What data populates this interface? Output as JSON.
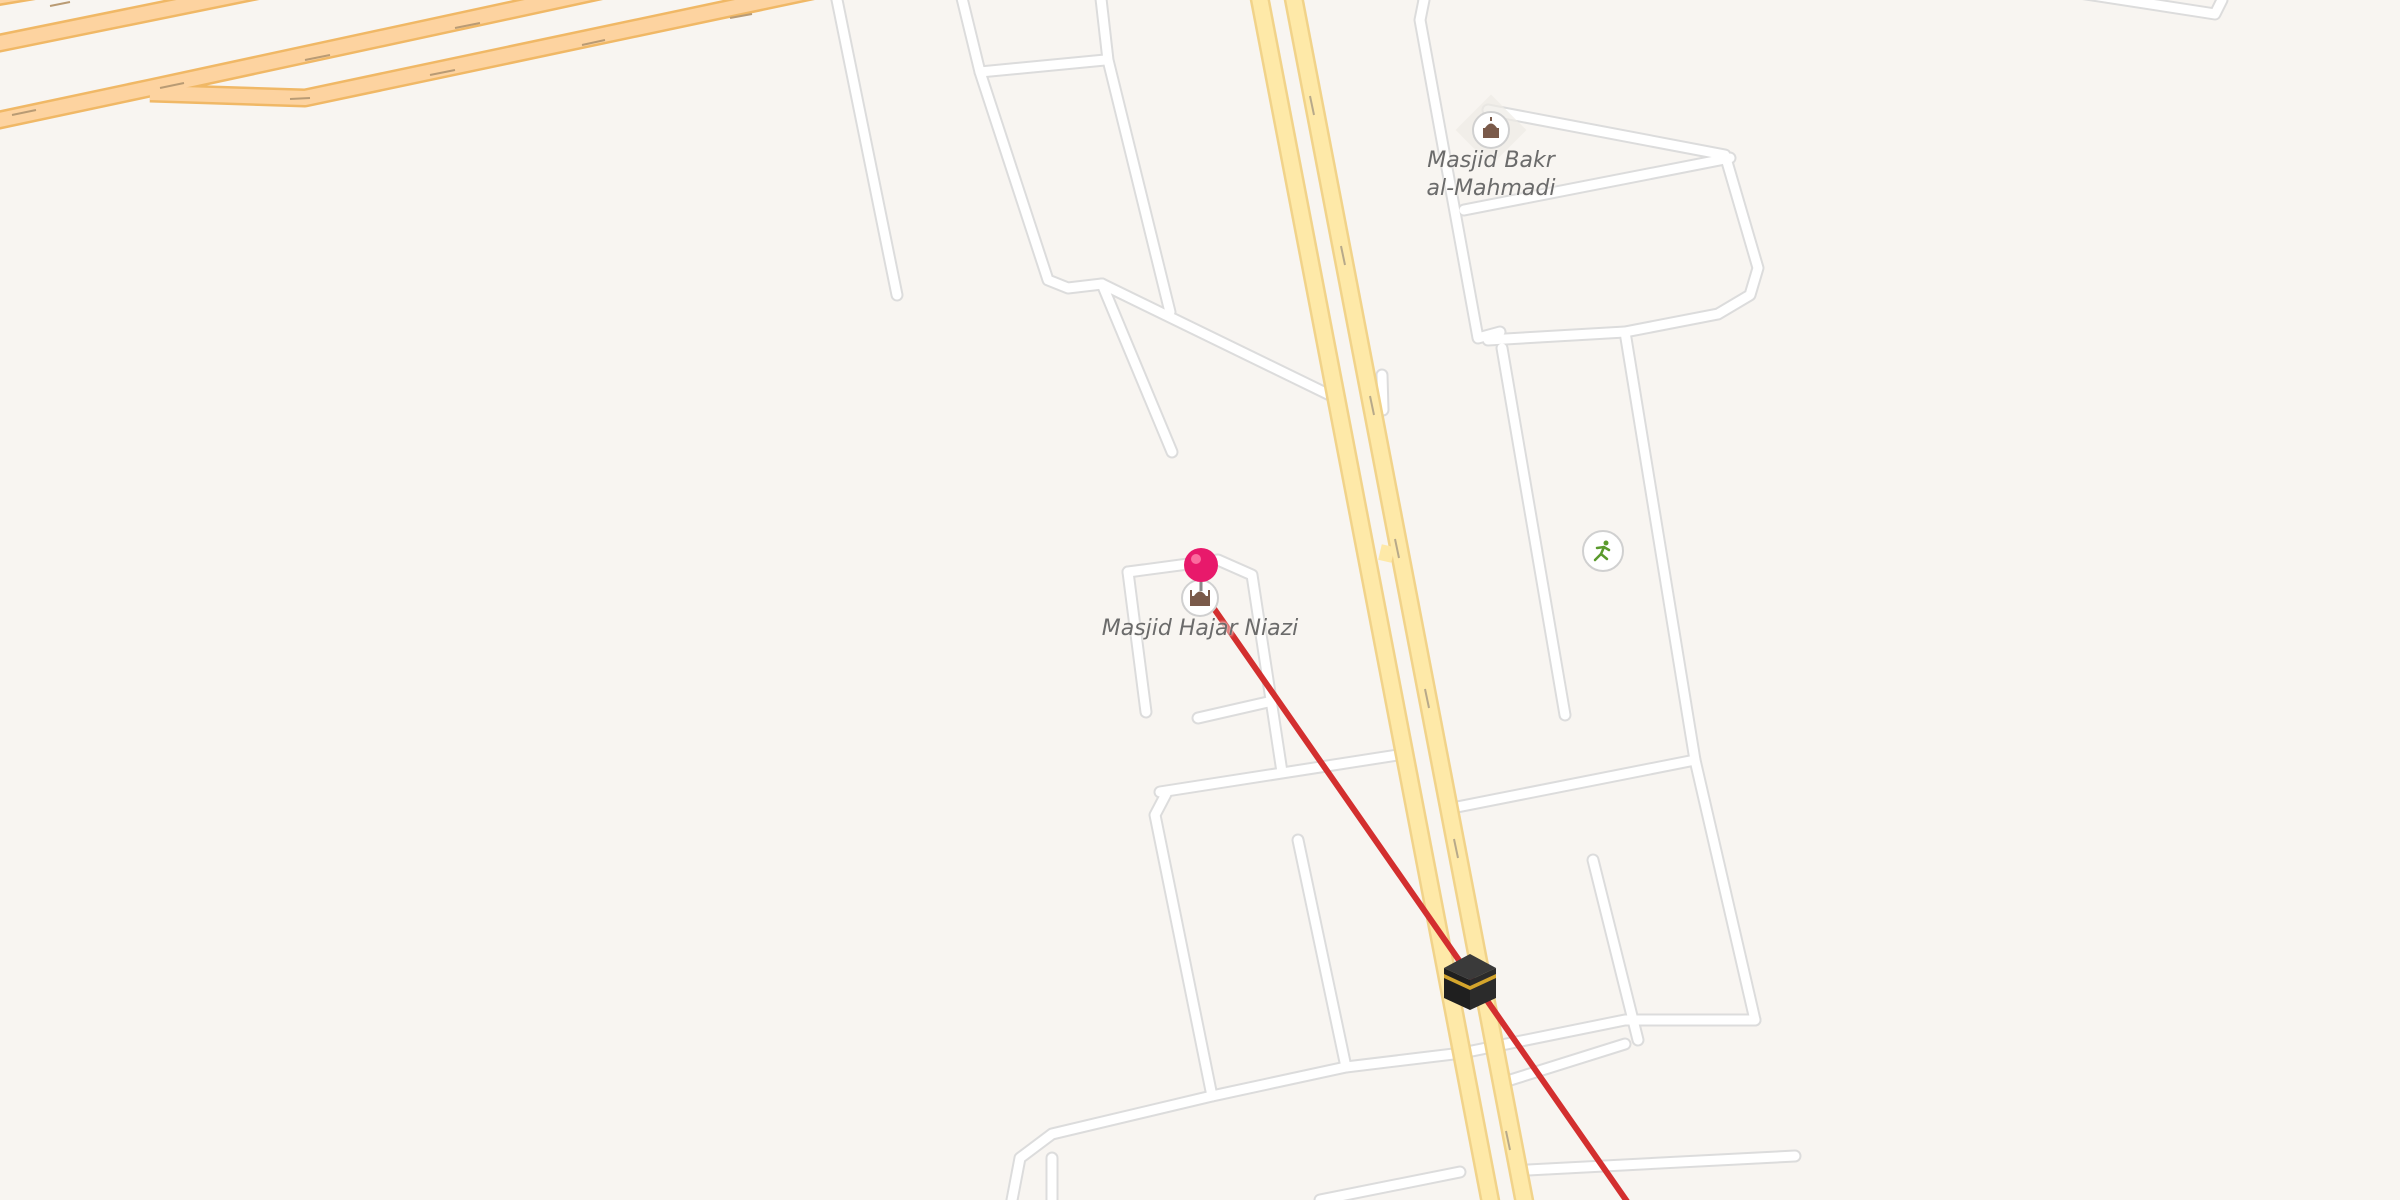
{
  "map": {
    "background": "#f8f5f1",
    "colors": {
      "road_casing": "#dcdcdc",
      "road_fill": "#ffffff",
      "trunk_casing": "#f0b866",
      "trunk_fill": "#fdd3a0",
      "primary_casing": "#f1d38a",
      "primary_fill": "#fee9a8",
      "qibla_line": "#d32f2f",
      "pin": "#e8196b"
    },
    "pois": [
      {
        "label": "Masjid Bakr\nal-Mahmadi",
        "icon": "mosque-icon"
      },
      {
        "label": "Masjid Hajar Niazi",
        "icon": "mosque-icon"
      },
      {
        "label": "",
        "icon": "sports-icon"
      }
    ],
    "markers": {
      "pin": "location-pin-icon",
      "qibla": "kaaba-icon"
    }
  }
}
